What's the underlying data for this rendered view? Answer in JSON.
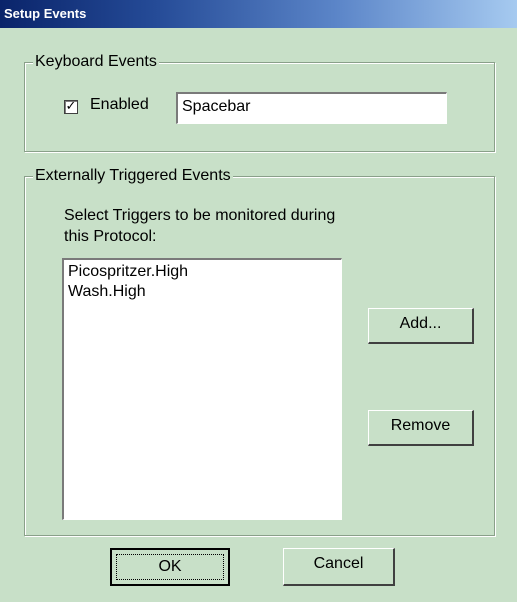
{
  "window": {
    "title": "Setup Events"
  },
  "keyboard_events": {
    "group_label": "Keyboard Events",
    "enabled_label": "Enabled",
    "enabled_checked": true,
    "check_glyph": "✓",
    "key_value": "Spacebar"
  },
  "external_events": {
    "group_label": "Externally Triggered Events",
    "instruction": "Select Triggers to be monitored during this Protocol:",
    "triggers": [
      "Picospritzer.High",
      "Wash.High"
    ],
    "add_label": "Add...",
    "remove_label": "Remove"
  },
  "footer": {
    "ok_label": "OK",
    "cancel_label": "Cancel"
  }
}
